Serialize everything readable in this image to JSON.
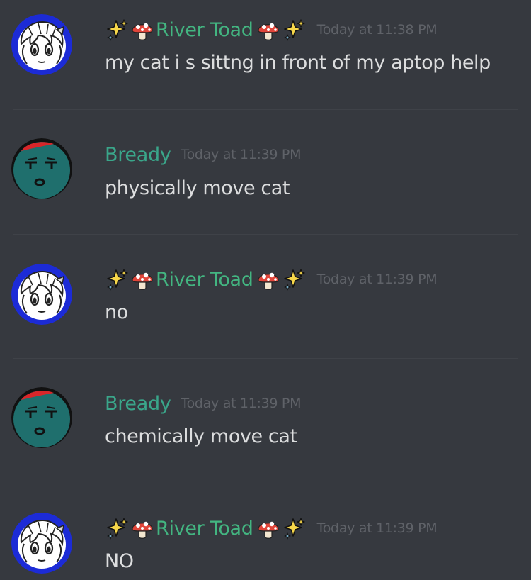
{
  "theme": {
    "background": "#36393f",
    "username_color": "#43b581",
    "bready_color": "#3aa68a",
    "timestamp_color": "#5f6268",
    "message_color": "#dcddde"
  },
  "messages": [
    {
      "author": "River Toad",
      "author_prefix_icons": [
        "sparkles-icon",
        "mushroom-icon"
      ],
      "author_suffix_icons": [
        "mushroom-icon",
        "sparkles-icon"
      ],
      "avatar_icon": "river-toad-avatar",
      "timestamp": "Today at 11:38 PM",
      "content": "my cat i s sittng in front of my aptop help"
    },
    {
      "author": "Bready",
      "avatar_icon": "bready-avatar",
      "timestamp": "Today at 11:39 PM",
      "content": "physically move cat"
    },
    {
      "author": "River Toad",
      "author_prefix_icons": [
        "sparkles-icon",
        "mushroom-icon"
      ],
      "author_suffix_icons": [
        "mushroom-icon",
        "sparkles-icon"
      ],
      "avatar_icon": "river-toad-avatar",
      "timestamp": "Today at 11:39 PM",
      "content": "no"
    },
    {
      "author": "Bready",
      "avatar_icon": "bready-avatar",
      "timestamp": "Today at 11:39 PM",
      "content": "chemically move cat"
    },
    {
      "author": "River Toad",
      "author_prefix_icons": [
        "sparkles-icon",
        "mushroom-icon"
      ],
      "author_suffix_icons": [
        "mushroom-icon",
        "sparkles-icon"
      ],
      "avatar_icon": "river-toad-avatar",
      "timestamp": "Today at 11:39 PM",
      "content": "NO"
    }
  ]
}
